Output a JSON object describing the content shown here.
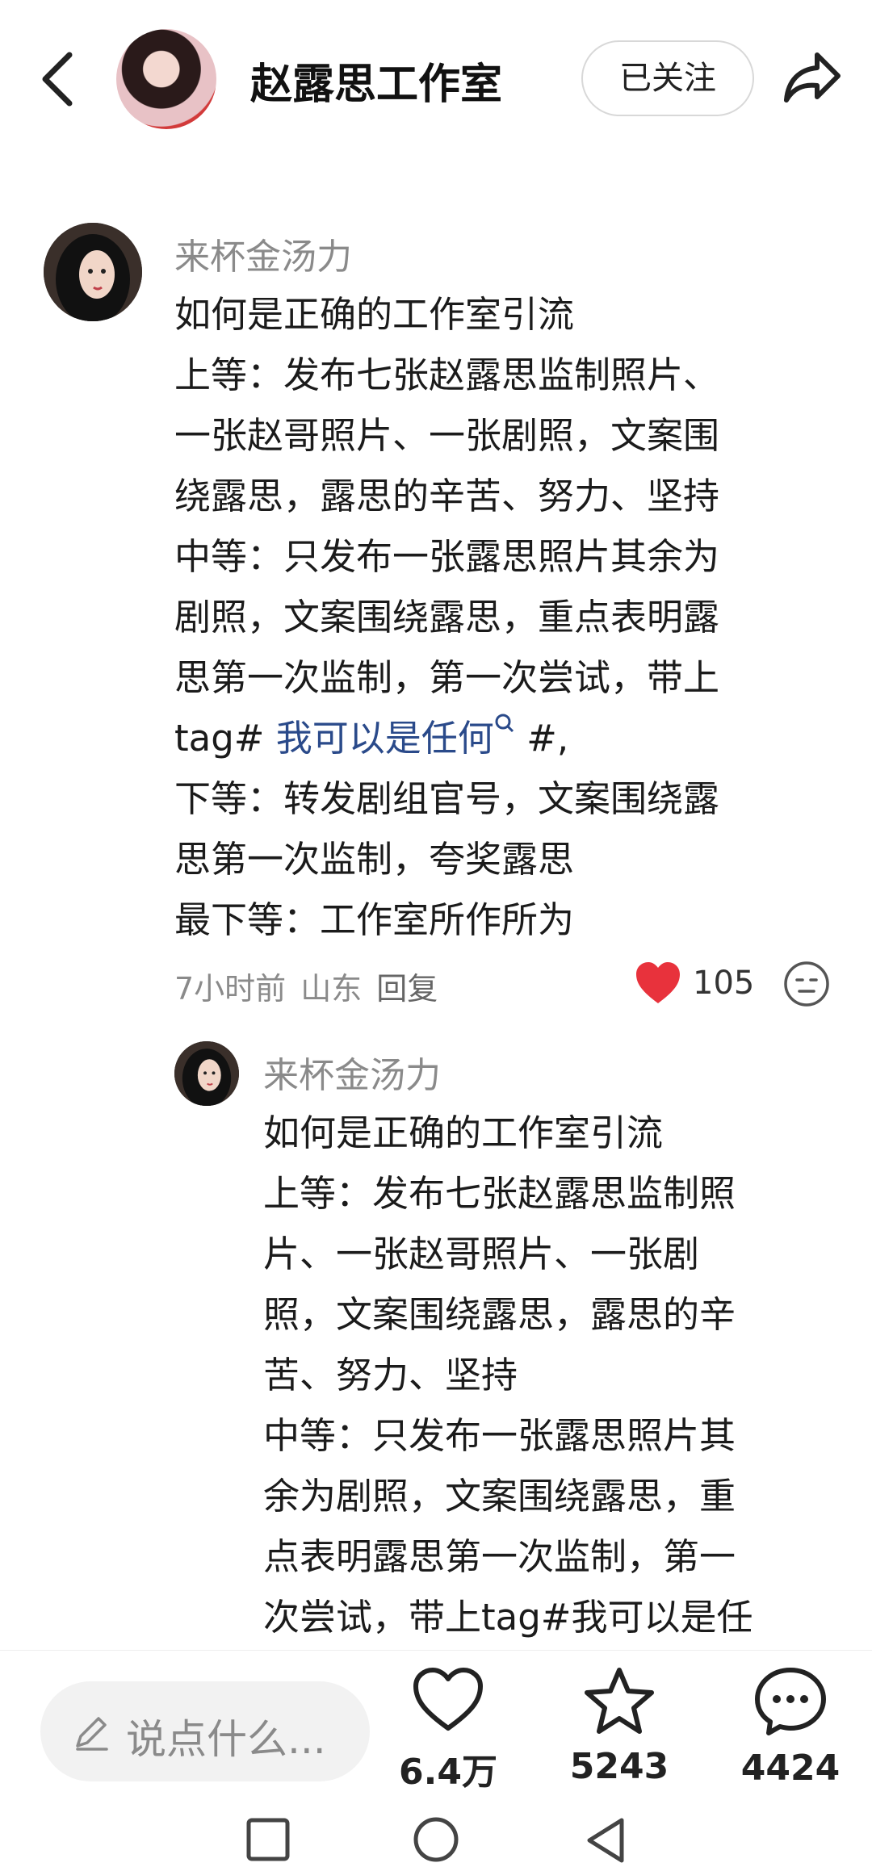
{
  "header": {
    "title": "赵露思工作室",
    "follow_label": "已关注"
  },
  "comment": {
    "username": "来杯金汤力",
    "lines": [
      "如何是正确的工作室引流",
      "上等：发布七张赵露思监制照片、",
      "一张赵哥照片、一张剧照，文案围",
      "绕露思，露思的辛苦、努力、坚持",
      "中等：只发布一张露思照片其余为",
      "剧照，文案围绕露思，重点表明露",
      "思第一次监制，第一次尝试，带上"
    ],
    "tag_prefix": "tag# ",
    "tag_link": "我可以是任何",
    "tag_suffix": " #,",
    "lines2": [
      "下等：转发剧组官号，文案围绕露",
      "思第一次监制，夸奖露思",
      "最下等：工作室所作所为"
    ],
    "time": "7小时前",
    "location": "山东",
    "reply_label": "回复",
    "like_count": "105"
  },
  "reply": {
    "username": "来杯金汤力",
    "lines": [
      "如何是正确的工作室引流",
      "上等：发布七张赵露思监制照",
      "片、一张赵哥照片、一张剧",
      "照，文案围绕露思，露思的辛",
      "苦、努力、坚持",
      "中等：只发布一张露思照片其",
      "余为剧照，文案围绕露思，重",
      "点表明露思第一次监制，第一",
      "次尝试，带上tag#我可以是任"
    ]
  },
  "bottom": {
    "input_placeholder": "说点什么...",
    "likes": "6.4万",
    "favorites": "5243",
    "comments": "4424"
  },
  "colors": {
    "heart": "#e8323c",
    "hashtag": "#2a4a8a",
    "muted": "#8a8a8a"
  },
  "icons": [
    "back-arrow-icon",
    "share-icon",
    "search-icon",
    "heart-icon",
    "emoji-icon",
    "pen-icon",
    "heart-outline-icon",
    "star-icon",
    "comment-icon",
    "square-nav-icon",
    "circle-nav-icon",
    "triangle-nav-icon"
  ]
}
